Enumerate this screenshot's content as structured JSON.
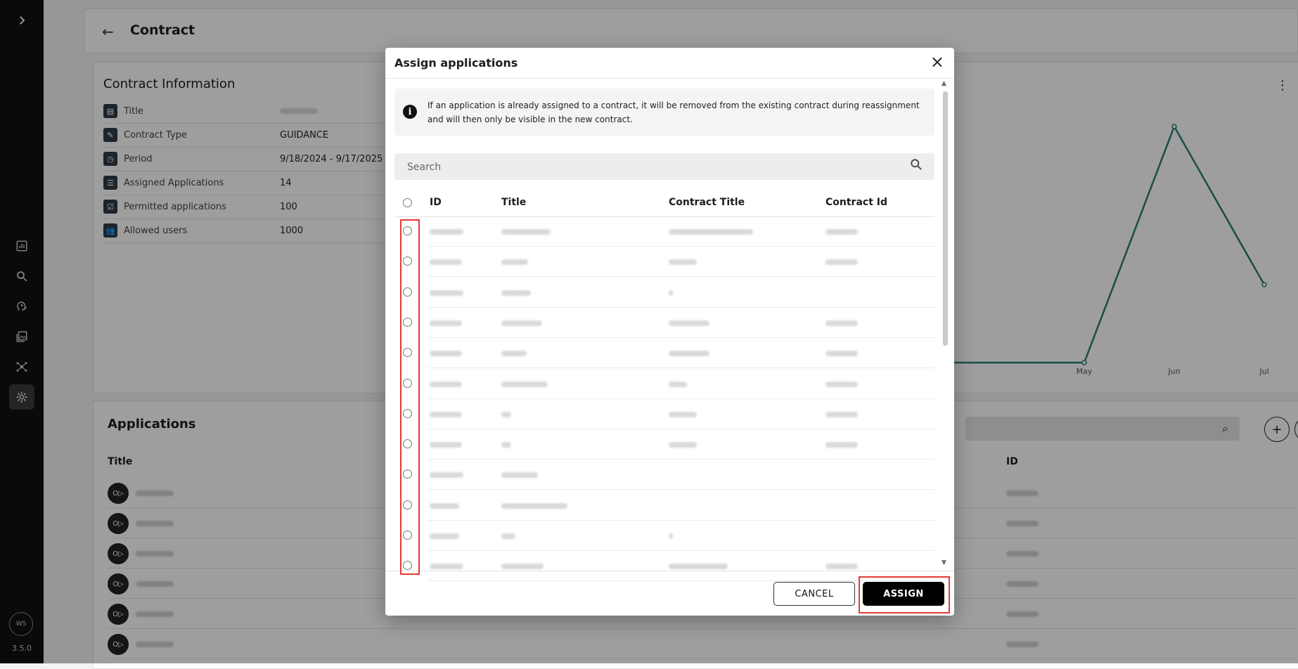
{
  "app": {
    "badge": "WS",
    "version": "3.5.0"
  },
  "colors": {
    "accent": "#2a7d73",
    "highlight": "#e53935",
    "sidebar": "#111111"
  },
  "header": {
    "title": "Contract"
  },
  "contract_info": {
    "title": "Contract Information",
    "rows": [
      {
        "label": "Title",
        "value": "",
        "icon": "document-icon"
      },
      {
        "label": "Contract Type",
        "value": "GUIDANCE",
        "icon": "wrench-icon"
      },
      {
        "label": "Period",
        "value": "9/18/2024 - 9/17/2025",
        "icon": "timer-icon"
      },
      {
        "label": "Assigned Applications",
        "value": "14",
        "icon": "list-icon"
      },
      {
        "label": "Permitted applications",
        "value": "100",
        "icon": "checklist-icon"
      },
      {
        "label": "Allowed users",
        "value": "1000",
        "icon": "users-icon"
      }
    ]
  },
  "chart_data": {
    "type": "line",
    "categories": [
      "May",
      "Jun",
      "Jul"
    ],
    "values": [
      0,
      1,
      0.33
    ],
    "ylim": [
      0,
      1
    ],
    "grid": false
  },
  "applications": {
    "title": "Applications",
    "columns": {
      "title": "Title",
      "id": "ID"
    }
  },
  "dialog": {
    "title": "Assign applications",
    "notice": "If an application is already assigned to a contract, it will be removed from the existing contract during reassignment and will then only be visible in the new contract.",
    "search_placeholder": "Search",
    "columns": {
      "id": "ID",
      "title": "Title",
      "contract_title": "Contract Title",
      "contract_id": "Contract Id"
    },
    "cancel_label": "CANCEL",
    "assign_label": "ASSIGN"
  }
}
